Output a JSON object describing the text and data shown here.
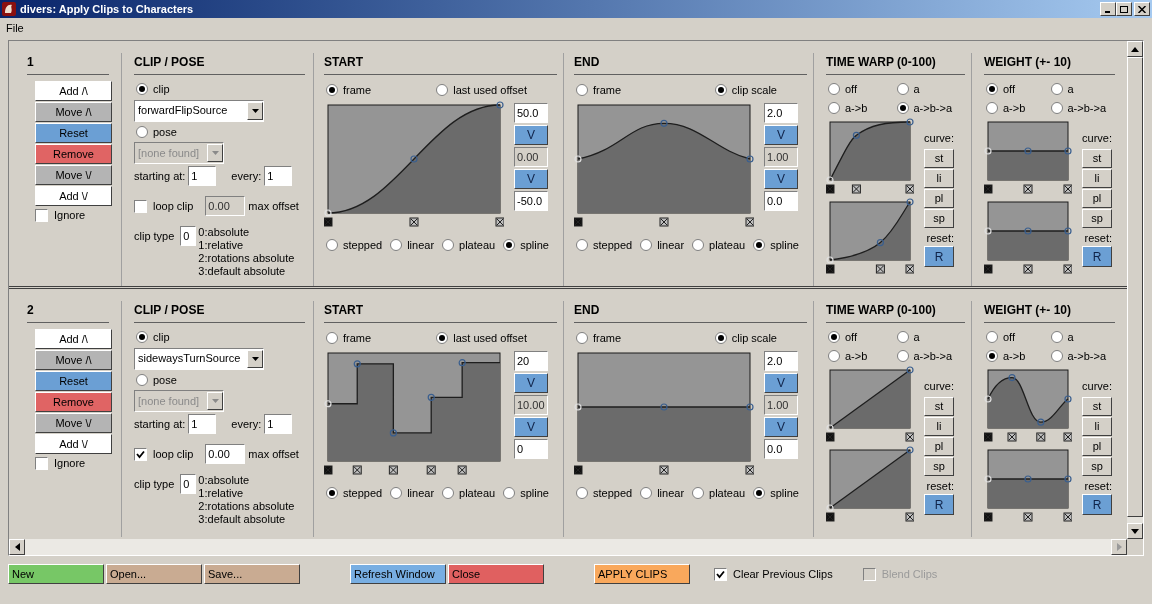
{
  "window": {
    "title": "divers: Apply Clips to Characters"
  },
  "menu": [
    "File"
  ],
  "blocks": [
    {
      "number": "1",
      "buttons": [
        {
          "label": "Add /\\",
          "color": "#ffffff"
        },
        {
          "label": "Move /\\",
          "color": "#b4b4b4"
        },
        {
          "label": "Reset",
          "color": "#6b9fd4"
        },
        {
          "label": "Remove",
          "color": "#e06464"
        },
        {
          "label": "Move \\/",
          "color": "#b4b4b4"
        },
        {
          "label": "Add \\/",
          "color": "#ffffff"
        }
      ],
      "ignore": {
        "label": "Ignore",
        "checked": false
      },
      "clip_pose": {
        "heading": "CLIP / POSE",
        "clip": {
          "label": "clip",
          "selected": true
        },
        "clip_value": "forwardFlipSource",
        "pose": {
          "label": "pose",
          "selected": false
        },
        "pose_value": "[none found]",
        "starting_label": "starting at:",
        "starting_value": "1",
        "every_label": "every:",
        "every_value": "1",
        "loop": {
          "label": "loop clip",
          "checked": false
        },
        "offset": {
          "value": "0.00",
          "disabled": true
        },
        "offset_label": "max offset",
        "type_label": "clip type",
        "type_value": "0",
        "type_options": [
          "0:absolute",
          "1:relative",
          "2:rotations absolute",
          "3:default absolute"
        ]
      },
      "start": {
        "heading": "START",
        "modes": [
          {
            "label": "frame",
            "selected": true
          },
          {
            "label": "last used offset",
            "selected": false
          }
        ],
        "curve": {
          "kind": "s-rise"
        },
        "fields": [
          {
            "value": "50.0",
            "disabled": false
          },
          {
            "value": "0.00",
            "disabled": true
          },
          {
            "value": "-50.0",
            "disabled": false
          }
        ],
        "steps": [
          "V",
          "V"
        ],
        "interp": [
          {
            "label": "stepped",
            "selected": false
          },
          {
            "label": "linear",
            "selected": false
          },
          {
            "label": "plateau",
            "selected": false
          },
          {
            "label": "spline",
            "selected": true
          }
        ]
      },
      "end": {
        "heading": "END",
        "modes": [
          {
            "label": "frame",
            "selected": false
          },
          {
            "label": "clip scale",
            "selected": true
          }
        ],
        "curve": {
          "kind": "hump"
        },
        "fields": [
          {
            "value": "2.0",
            "disabled": false
          },
          {
            "value": "1.00",
            "disabled": true
          },
          {
            "value": "0.0",
            "disabled": false
          }
        ],
        "steps": [
          "V",
          "V"
        ],
        "interp": [
          {
            "label": "stepped",
            "selected": false
          },
          {
            "label": "linear",
            "selected": false
          },
          {
            "label": "plateau",
            "selected": false
          },
          {
            "label": "spline",
            "selected": true
          }
        ]
      },
      "time_warp": {
        "heading": "TIME WARP (0-100)",
        "modes": [
          {
            "label": "off",
            "selected": false
          },
          {
            "label": "a",
            "selected": false
          },
          {
            "label": "a->b",
            "selected": false
          },
          {
            "label": "a->b->a",
            "selected": true
          }
        ],
        "curves": [
          {
            "kind": "ease-out"
          },
          {
            "kind": "ease-in"
          }
        ],
        "curve_label": "curve:",
        "curve_buttons": [
          "st",
          "li",
          "pl",
          "sp"
        ],
        "reset_label": "reset:",
        "reset": "R"
      },
      "weight": {
        "heading": "WEIGHT (+- 10)",
        "modes": [
          {
            "label": "off",
            "selected": true
          },
          {
            "label": "a",
            "selected": false
          },
          {
            "label": "a->b",
            "selected": false
          },
          {
            "label": "a->b->a",
            "selected": false
          }
        ],
        "curves": [
          {
            "kind": "flat"
          },
          {
            "kind": "flat"
          }
        ],
        "curve_label": "curve:",
        "curve_buttons": [
          "st",
          "li",
          "pl",
          "sp"
        ],
        "reset_label": "reset:",
        "reset": "R"
      }
    },
    {
      "number": "2",
      "buttons": [
        {
          "label": "Add /\\",
          "color": "#ffffff"
        },
        {
          "label": "Move /\\",
          "color": "#b4b4b4"
        },
        {
          "label": "Reset",
          "color": "#6b9fd4"
        },
        {
          "label": "Remove",
          "color": "#e06464"
        },
        {
          "label": "Move \\/",
          "color": "#b4b4b4"
        },
        {
          "label": "Add \\/",
          "color": "#ffffff"
        }
      ],
      "ignore": {
        "label": "Ignore",
        "checked": false
      },
      "clip_pose": {
        "heading": "CLIP / POSE",
        "clip": {
          "label": "clip",
          "selected": true
        },
        "clip_value": "sidewaysTurnSource",
        "pose": {
          "label": "pose",
          "selected": false
        },
        "pose_value": "[none found]",
        "starting_label": "starting at:",
        "starting_value": "1",
        "every_label": "every:",
        "every_value": "1",
        "loop": {
          "label": "loop clip",
          "checked": true
        },
        "offset": {
          "value": "0.00",
          "disabled": false
        },
        "offset_label": "max offset",
        "type_label": "clip type",
        "type_value": "0",
        "type_options": [
          "0:absolute",
          "1:relative",
          "2:rotations absolute",
          "3:default absolute"
        ]
      },
      "start": {
        "heading": "START",
        "modes": [
          {
            "label": "frame",
            "selected": false
          },
          {
            "label": "last used offset",
            "selected": true
          }
        ],
        "curve": {
          "kind": "steps"
        },
        "fields": [
          {
            "value": "20",
            "disabled": false
          },
          {
            "value": "10.00",
            "disabled": true
          },
          {
            "value": "0",
            "disabled": false
          }
        ],
        "steps": [
          "V",
          "V"
        ],
        "interp": [
          {
            "label": "stepped",
            "selected": true
          },
          {
            "label": "linear",
            "selected": false
          },
          {
            "label": "plateau",
            "selected": false
          },
          {
            "label": "spline",
            "selected": false
          }
        ]
      },
      "end": {
        "heading": "END",
        "modes": [
          {
            "label": "frame",
            "selected": false
          },
          {
            "label": "clip scale",
            "selected": true
          }
        ],
        "curve": {
          "kind": "flat"
        },
        "fields": [
          {
            "value": "2.0",
            "disabled": false
          },
          {
            "value": "1.00",
            "disabled": true
          },
          {
            "value": "0.0",
            "disabled": false
          }
        ],
        "steps": [
          "V",
          "V"
        ],
        "interp": [
          {
            "label": "stepped",
            "selected": false
          },
          {
            "label": "linear",
            "selected": false
          },
          {
            "label": "plateau",
            "selected": false
          },
          {
            "label": "spline",
            "selected": true
          }
        ]
      },
      "time_warp": {
        "heading": "TIME WARP (0-100)",
        "modes": [
          {
            "label": "off",
            "selected": true
          },
          {
            "label": "a",
            "selected": false
          },
          {
            "label": "a->b",
            "selected": false
          },
          {
            "label": "a->b->a",
            "selected": false
          }
        ],
        "curves": [
          {
            "kind": "linear"
          },
          {
            "kind": "linear"
          }
        ],
        "curve_label": "curve:",
        "curve_buttons": [
          "st",
          "li",
          "pl",
          "sp"
        ],
        "reset_label": "reset:",
        "reset": "R"
      },
      "weight": {
        "heading": "WEIGHT (+- 10)",
        "modes": [
          {
            "label": "off",
            "selected": false
          },
          {
            "label": "a",
            "selected": false
          },
          {
            "label": "a->b",
            "selected": true
          },
          {
            "label": "a->b->a",
            "selected": false
          }
        ],
        "curves": [
          {
            "kind": "wave"
          },
          {
            "kind": "flat"
          }
        ],
        "curve_label": "curve:",
        "curve_buttons": [
          "st",
          "li",
          "pl",
          "sp"
        ],
        "reset_label": "reset:",
        "reset": "R"
      }
    }
  ],
  "bottom": {
    "button_groups": [
      [
        {
          "label": "New",
          "color": "#77c766"
        },
        {
          "label": "Open...",
          "color": "#c9ab92"
        },
        {
          "label": "Save...",
          "color": "#c9ab92"
        }
      ],
      [
        {
          "label": "Refresh Window",
          "color": "#78aee2"
        },
        {
          "label": "Close",
          "color": "#e06060"
        }
      ],
      [
        {
          "label": "APPLY CLIPS",
          "color": "#f9a85c"
        }
      ]
    ],
    "options": [
      {
        "label": "Clear Previous Clips",
        "checked": true,
        "disabled": false
      },
      {
        "label": "Blend Clips",
        "checked": false,
        "disabled": true
      }
    ]
  }
}
